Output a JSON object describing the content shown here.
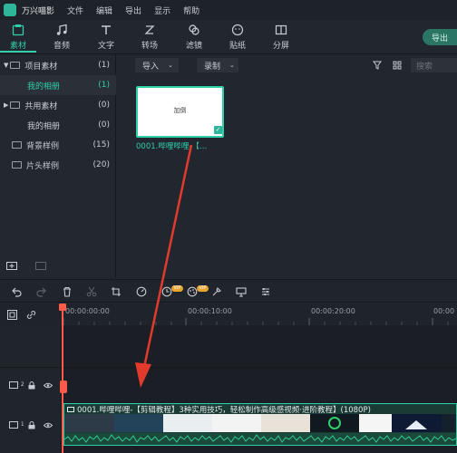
{
  "app": {
    "title": "万兴喵影"
  },
  "menu": [
    "文件",
    "编辑",
    "导出",
    "显示",
    "帮助"
  ],
  "toolbar": {
    "items": [
      {
        "label": "素材",
        "icon": "folder-media-icon"
      },
      {
        "label": "音频",
        "icon": "music-note-icon"
      },
      {
        "label": "文字",
        "icon": "text-t-icon"
      },
      {
        "label": "转场",
        "icon": "transition-icon"
      },
      {
        "label": "滤镜",
        "icon": "filter-icon"
      },
      {
        "label": "贴纸",
        "icon": "sticker-icon"
      },
      {
        "label": "分屏",
        "icon": "split-screen-icon"
      }
    ],
    "export_label": "导出"
  },
  "sidebar": {
    "items": [
      {
        "label": "项目素材",
        "count": "(1)"
      },
      {
        "label": "我的相册",
        "count": "(1)"
      },
      {
        "label": "共用素材",
        "count": "(0)"
      },
      {
        "label": "我的相册",
        "count": "(0)"
      },
      {
        "label": "背景样例",
        "count": "(15)"
      },
      {
        "label": "片头样例",
        "count": "(20)"
      }
    ]
  },
  "content": {
    "import_label": "导入",
    "record_label": "录制",
    "search_placeholder": "搜索",
    "thumb_text": "加倒",
    "thumb_name": "0001.哔哩哔哩-【…"
  },
  "editbar": {
    "vip1": "VIP",
    "vip2": "VIP"
  },
  "ruler": {
    "t0": "00:00:00:00",
    "t1": "00:00:10:00",
    "t2": "00:00:20:00",
    "t3": "00:00"
  },
  "tracks": {
    "track2": "2",
    "track1": "1",
    "clip_label": "0001.哔哩哔哩-【剪辑教程】3种实用技巧，轻松制作高级感视频·进阶教程】(1080P)"
  },
  "colors": {
    "accent": "#2fcfa9",
    "playhead": "#ff5a4a",
    "vip": "#e8a630",
    "arrow": "#e23b2e"
  }
}
